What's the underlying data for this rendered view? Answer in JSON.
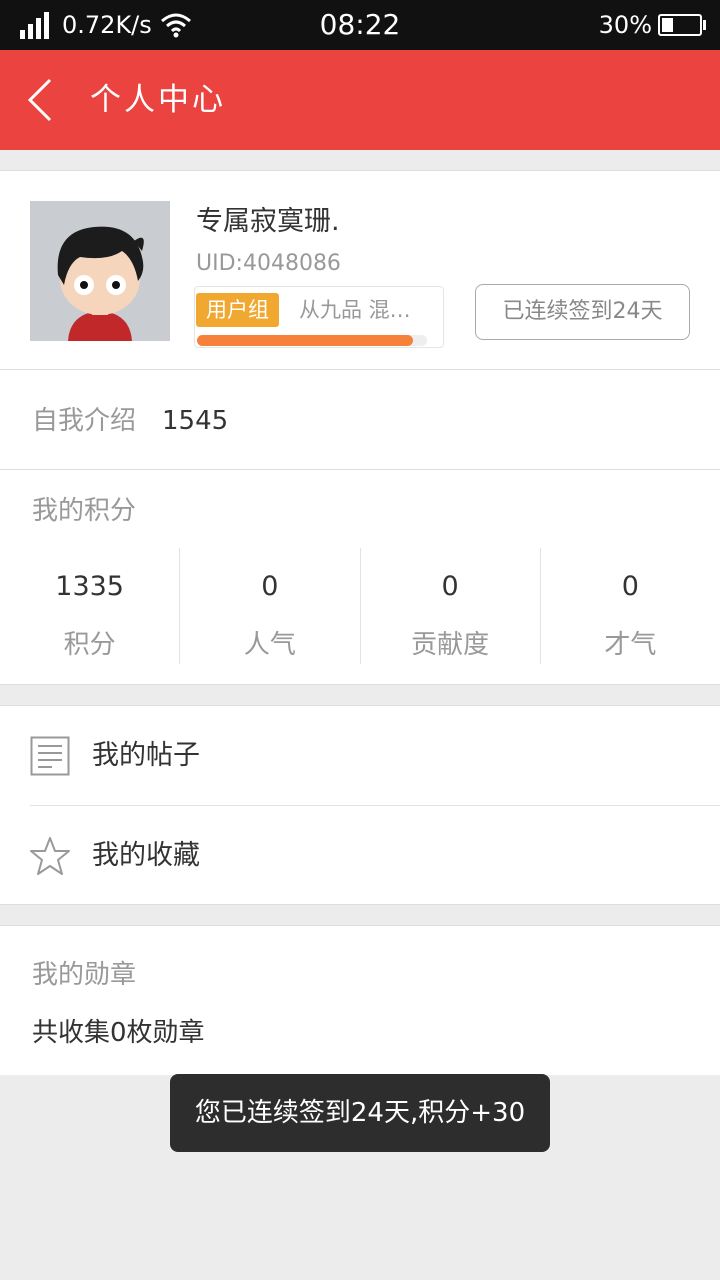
{
  "status_bar": {
    "net_speed": "0.72K/s",
    "time": "08:22",
    "battery_percent": "30%",
    "battery_level": 0.3,
    "signal_bars": 4
  },
  "header": {
    "back_icon": "chevron-left-icon",
    "title": "个人中心"
  },
  "profile": {
    "username": "专属寂寞珊.",
    "uid_label": "UID: ",
    "uid_value": "4048086",
    "group_tag": "用户组",
    "group_name": "从九品 混…",
    "group_progress": 0.94,
    "checkin_label": "已连续签到24天"
  },
  "intro": {
    "label": "自我介绍",
    "value": "1545"
  },
  "points": {
    "title": "我的积分",
    "items": [
      {
        "value": "1335",
        "label": "积分"
      },
      {
        "value": "0",
        "label": "人气"
      },
      {
        "value": "0",
        "label": "贡献度"
      },
      {
        "value": "0",
        "label": "才气"
      }
    ]
  },
  "menu": {
    "items": [
      {
        "icon": "document-icon",
        "label": "我的帖子"
      },
      {
        "icon": "star-icon",
        "label": "我的收藏"
      }
    ]
  },
  "medals": {
    "title": "我的勋章",
    "summary": "共收集0枚勋章"
  },
  "toast": {
    "message": "您已连续签到24天,积分+30"
  },
  "colors": {
    "header_bg": "#ea4340",
    "group_tag_bg": "#f0a830",
    "progress_fill": "#f5813a",
    "toast_bg": "#2d2d2d"
  }
}
